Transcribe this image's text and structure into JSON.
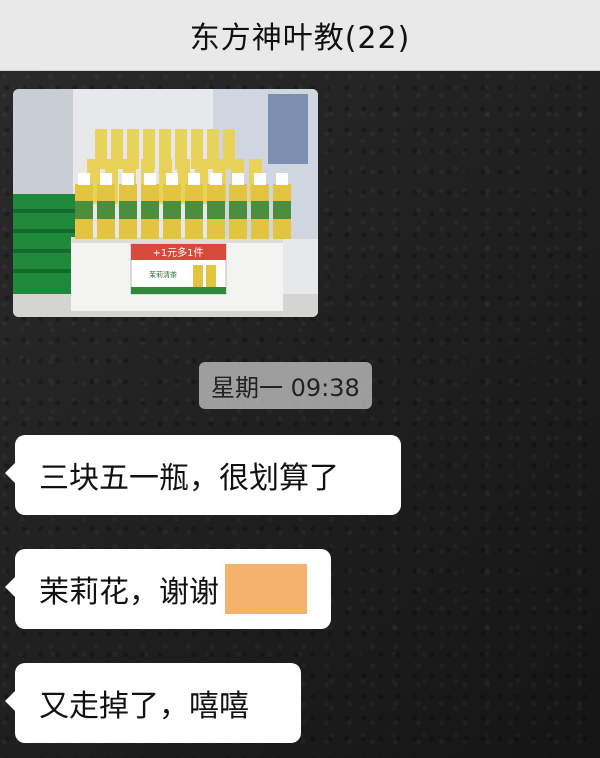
{
  "header": {
    "title": "东方神叶教(22)"
  },
  "image_message": {
    "price_tag_line1": "+1元多1件",
    "price_tag_line2": "茉莉清茶"
  },
  "timestamp": "星期一 09:38",
  "messages": [
    {
      "text": "三块五一瓶，很划算了"
    },
    {
      "text": "茉莉花，谢谢",
      "redacted": true
    },
    {
      "text": "又走掉了，嘻嘻"
    }
  ],
  "colors": {
    "header_bg": "#e9e9e9",
    "bubble_bg": "#ffffff",
    "redaction": "#f4b26c",
    "timestamp_bg": "#c8c8c8"
  }
}
